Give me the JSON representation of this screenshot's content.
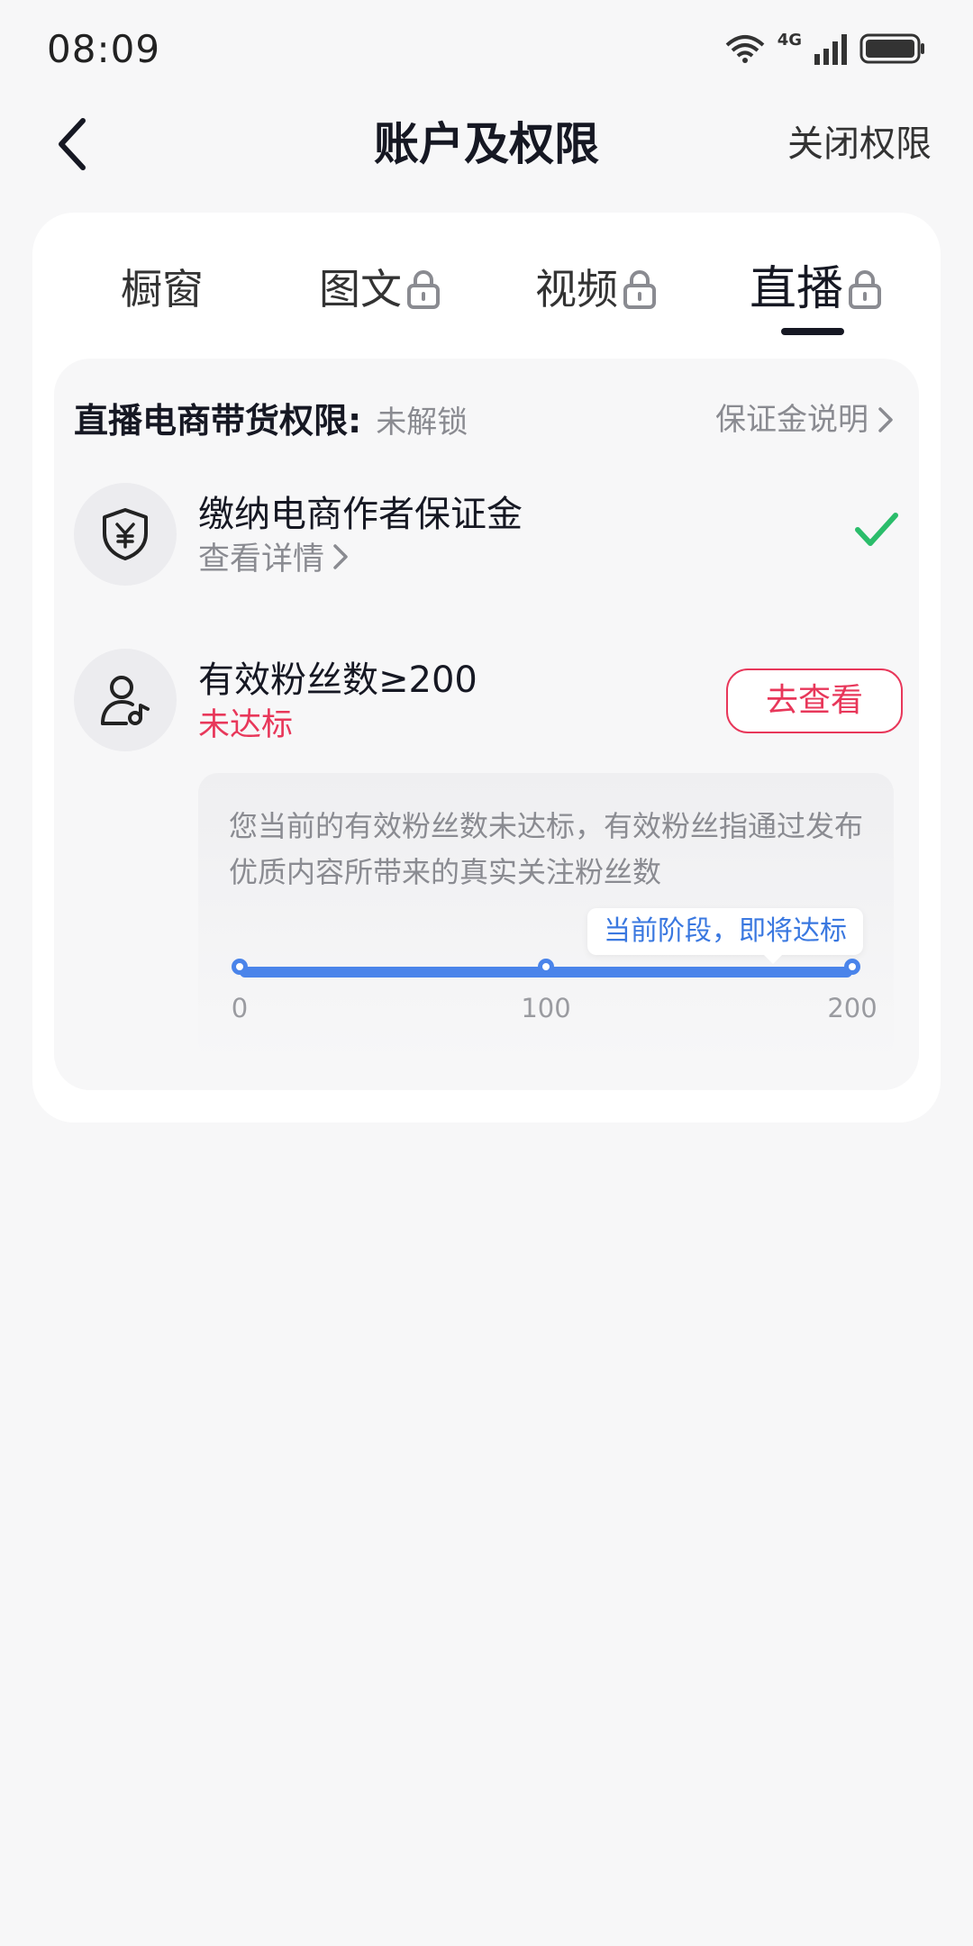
{
  "status_bar": {
    "time": "08:09",
    "network": "4G"
  },
  "nav": {
    "title": "账户及权限",
    "right_action": "关闭权限"
  },
  "tabs": [
    {
      "label": "橱窗",
      "locked": false,
      "active": false
    },
    {
      "label": "图文",
      "locked": true,
      "active": false
    },
    {
      "label": "视频",
      "locked": true,
      "active": false
    },
    {
      "label": "直播",
      "locked": true,
      "active": true
    }
  ],
  "permission": {
    "title": "直播电商带货权限:",
    "status": "未解锁",
    "deposit_link": "保证金说明"
  },
  "requirements": [
    {
      "icon": "shield-yuan-icon",
      "title": "缴纳电商作者保证金",
      "sub_link": "查看详情",
      "done": true
    },
    {
      "icon": "user-music-icon",
      "title": "有效粉丝数≥200",
      "status": "未达标",
      "button": "去查看",
      "info": "您当前的有效粉丝数未达标，有效粉丝指通过发布优质内容所带来的真实关注粉丝数",
      "tooltip": "当前阶段，即将达标",
      "progress": {
        "ticks": [
          "0",
          "100",
          "200"
        ],
        "value_fraction": 1.0
      }
    }
  ],
  "colors": {
    "accent": "#e8375a",
    "progress": "#4a84ea",
    "success": "#2bbd6b"
  }
}
